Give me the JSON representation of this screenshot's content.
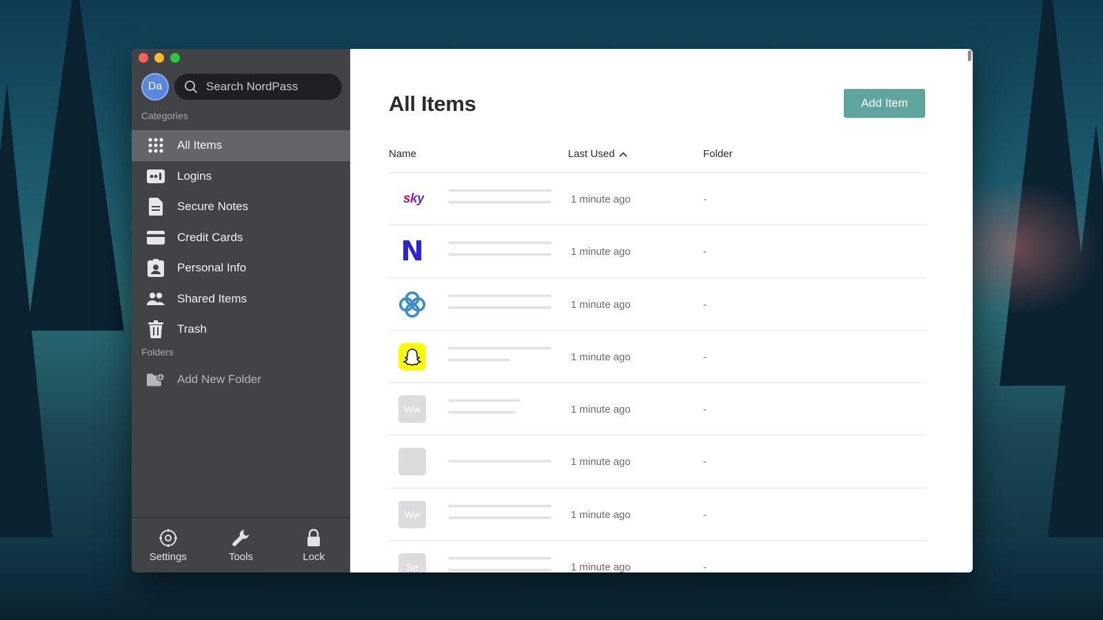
{
  "window": {
    "traffic_lights": [
      "close",
      "minimize",
      "maximize"
    ]
  },
  "sidebar": {
    "avatar_initials": "Da",
    "search_placeholder": "Search NordPass",
    "categories_label": "Categories",
    "items": [
      {
        "label": "All Items",
        "icon": "grid-icon",
        "active": true
      },
      {
        "label": "Logins",
        "icon": "login-card-icon",
        "active": false
      },
      {
        "label": "Secure Notes",
        "icon": "note-icon",
        "active": false
      },
      {
        "label": "Credit Cards",
        "icon": "credit-card-icon",
        "active": false
      },
      {
        "label": "Personal Info",
        "icon": "id-badge-icon",
        "active": false
      },
      {
        "label": "Shared Items",
        "icon": "people-icon",
        "active": false
      },
      {
        "label": "Trash",
        "icon": "trash-icon",
        "active": false
      }
    ],
    "folders_label": "Folders",
    "add_folder_label": "Add New Folder",
    "footer": {
      "settings": "Settings",
      "tools": "Tools",
      "lock": "Lock"
    }
  },
  "main": {
    "title": "All Items",
    "add_button": "Add Item",
    "columns": {
      "name": "Name",
      "last_used": "Last Used",
      "folder": "Folder"
    },
    "rows": [
      {
        "logo": "sky",
        "logo_text": "sky",
        "last_used": "1 minute ago",
        "folder": "-"
      },
      {
        "logo": "n-logo",
        "logo_text": "N",
        "last_used": "1 minute ago",
        "folder": "-"
      },
      {
        "logo": "flower-logo",
        "logo_text": "",
        "last_used": "1 minute ago",
        "folder": "-"
      },
      {
        "logo": "snapchat",
        "logo_text": "",
        "last_used": "1 minute ago",
        "folder": "-"
      },
      {
        "logo": "placeholder",
        "logo_text": "Ww",
        "last_used": "1 minute ago",
        "folder": "-"
      },
      {
        "logo": "placeholder",
        "logo_text": "",
        "last_used": "1 minute ago",
        "folder": "-"
      },
      {
        "logo": "placeholder",
        "logo_text": "Ww",
        "last_used": "1 minute ago",
        "folder": "-"
      },
      {
        "logo": "placeholder",
        "logo_text": "Se",
        "last_used": "1 minute ago",
        "folder": "-"
      }
    ]
  },
  "colors": {
    "sidebar_bg": "#424347",
    "active_item_bg": "#64656a",
    "accent": "#5ea59d"
  }
}
